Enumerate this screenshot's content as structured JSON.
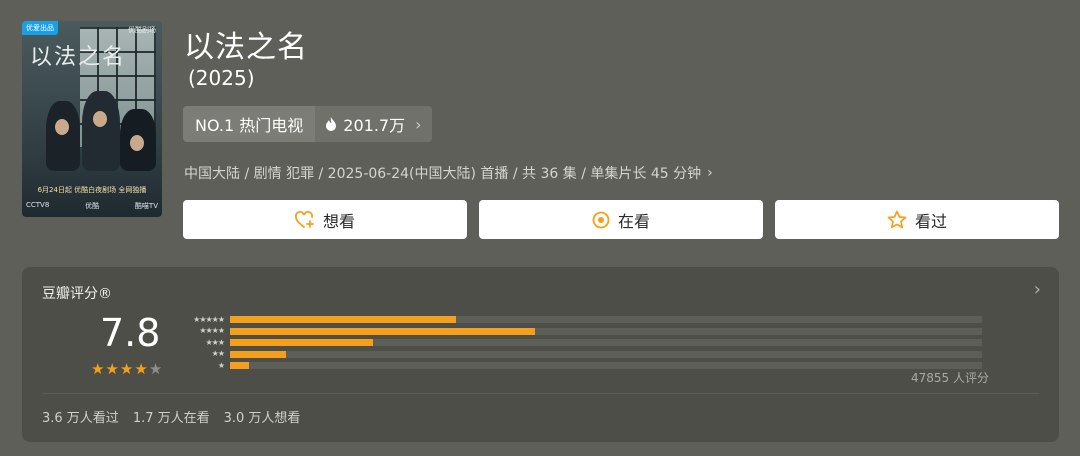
{
  "poster": {
    "badge": "优爱出品",
    "logo": "优酷剧场",
    "title_art": "以法之名",
    "promo_line1": "6月24日起 优酷白夜剧场 全网独播",
    "promo_line2": [
      "CCTV8",
      "优酷",
      "酷喵TV"
    ]
  },
  "show": {
    "title": "以法之名",
    "year": "(2025)",
    "rank": "NO.1 热门电视",
    "heat": "201.7万",
    "meta": "中国大陆 / 剧情 犯罪 / 2025-06-24(中国大陆) 首播 / 共 36 集 / 单集片长 45 分钟"
  },
  "actions": {
    "want": "想看",
    "watching": "在看",
    "watched": "看过"
  },
  "rating": {
    "title": "豆瓣评分®",
    "score": "7.8",
    "stars_filled": 4,
    "stars_total": 5,
    "distribution": [
      {
        "stars": "★★★★★",
        "fraction": 0.3
      },
      {
        "stars": "★★★★",
        "fraction": 0.406
      },
      {
        "stars": "★★★",
        "fraction": 0.19
      },
      {
        "stars": "★★",
        "fraction": 0.075
      },
      {
        "stars": "★",
        "fraction": 0.025
      }
    ],
    "votes": "47855 人评分",
    "stats": [
      "3.6 万人看过",
      "1.7 万人在看",
      "3.0 万人想看"
    ]
  },
  "colors": {
    "accent": "#f4a01c",
    "background": "#5e5f58",
    "card": "#4d4e48"
  }
}
